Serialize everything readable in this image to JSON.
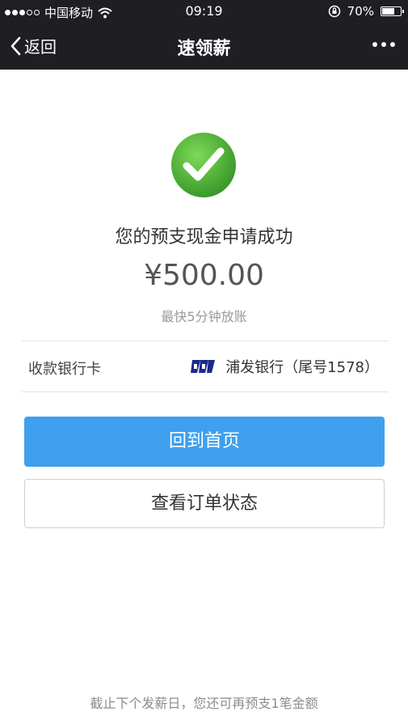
{
  "status_bar": {
    "carrier": "中国移动",
    "time": "09:19",
    "battery_text": "70%",
    "battery_level": 0.7,
    "signal_strength": 3,
    "signal_max": 5
  },
  "nav": {
    "back_label": "返回",
    "title": "速领薪"
  },
  "result": {
    "message": "您的预支现金申请成功",
    "amount": "¥500.00",
    "hint": "最快5分钟放账"
  },
  "bank": {
    "label": "收款银行卡",
    "value": "浦发银行（尾号1578）",
    "logo_icon": "spdb-bank-logo-icon",
    "logo_color": "#1a2a8c"
  },
  "actions": {
    "home_label": "回到首页",
    "order_status_label": "查看订单状态"
  },
  "footer": {
    "note": "截止下个发薪日，您还可再预支1笔金额"
  },
  "colors": {
    "header_bg": "#1f1f23",
    "primary_button": "#3ea0ee",
    "success_green": "#4db33a"
  }
}
